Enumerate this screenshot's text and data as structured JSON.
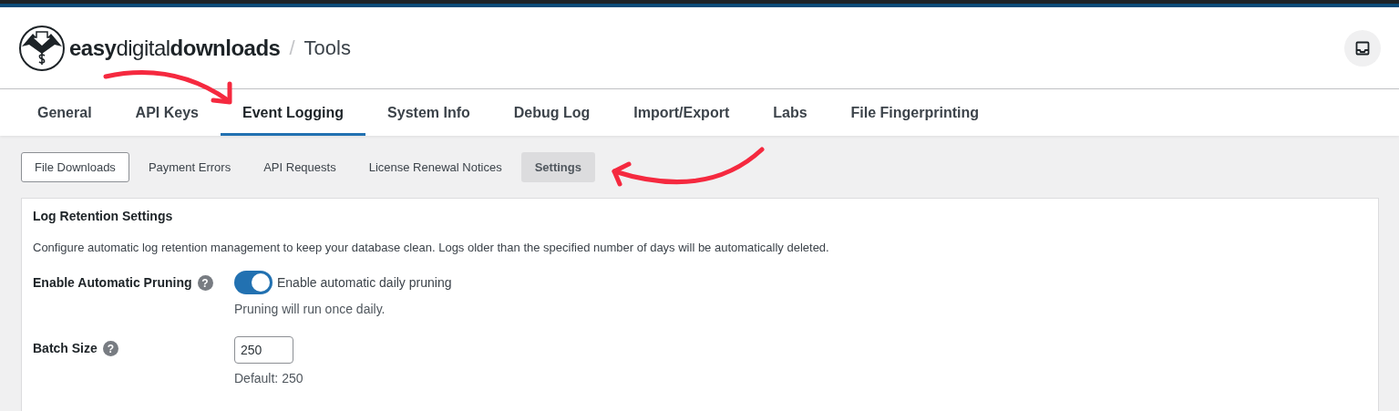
{
  "header": {
    "logo": {
      "part_1": "easy",
      "part_2": "digital",
      "part_3": "downloads"
    },
    "separator": "/",
    "title": "Tools"
  },
  "tabs": [
    {
      "label": "General",
      "selected": false
    },
    {
      "label": "API Keys",
      "selected": false
    },
    {
      "label": "Event Logging",
      "selected": true
    },
    {
      "label": "System Info",
      "selected": false
    },
    {
      "label": "Debug Log",
      "selected": false
    },
    {
      "label": "Import/Export",
      "selected": false
    },
    {
      "label": "Labs",
      "selected": false
    },
    {
      "label": "File Fingerprinting",
      "selected": false
    }
  ],
  "subtabs": [
    {
      "label": "File Downloads",
      "selected": false,
      "outlined": true
    },
    {
      "label": "Payment Errors",
      "selected": false,
      "outlined": false
    },
    {
      "label": "API Requests",
      "selected": false,
      "outlined": false
    },
    {
      "label": "License Renewal Notices",
      "selected": false,
      "outlined": false
    },
    {
      "label": "Settings",
      "selected": true,
      "outlined": false
    }
  ],
  "panel": {
    "title": "Log Retention Settings",
    "description": "Configure automatic log retention management to keep your database clean. Logs older than the specified number of days will be automatically deleted.",
    "fields": [
      {
        "kind": "toggle",
        "label": "Enable Automatic Pruning",
        "help": "?",
        "on": true,
        "toggle_label": "Enable automatic daily pruning",
        "note": "Pruning will run once daily."
      },
      {
        "kind": "number",
        "label": "Batch Size",
        "help": "?",
        "value": "250",
        "note": "Default: 250"
      }
    ]
  }
}
